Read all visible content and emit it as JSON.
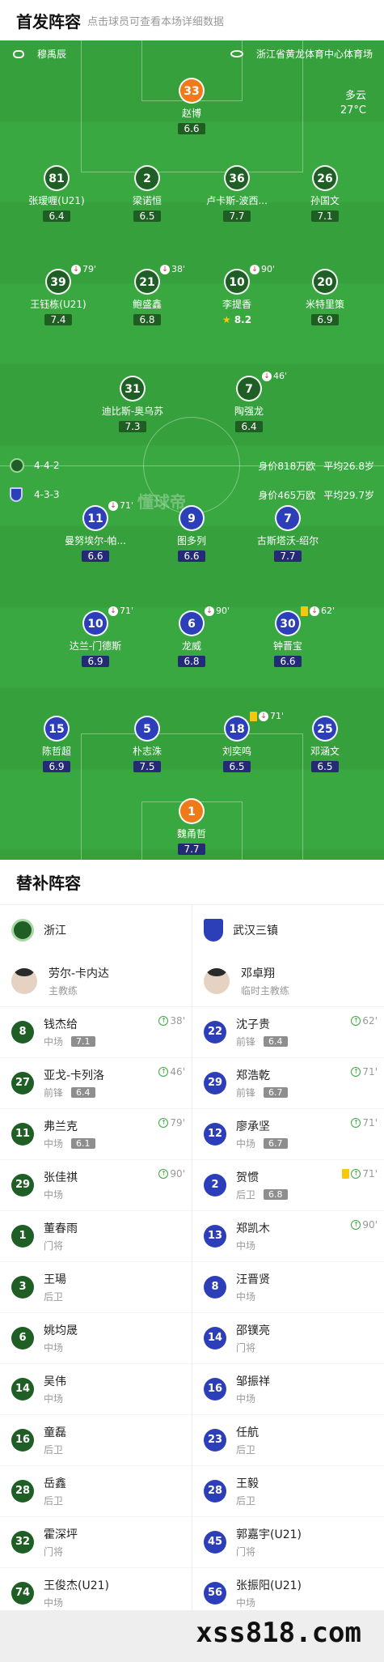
{
  "header": {
    "title": "首发阵容",
    "subtitle": "点击球员可查看本场详细数据"
  },
  "match_info": {
    "referee": "穆禹辰",
    "stadium": "浙江省黄龙体育中心体育场",
    "weather": "多云",
    "temperature": "27°C"
  },
  "watermark": "懂球帝",
  "home_team_info": {
    "formation": "4-4-2",
    "value": "身价818万欧",
    "age": "平均26.8岁"
  },
  "away_team_info": {
    "formation": "4-3-3",
    "value": "身价465万欧",
    "age": "平均29.7岁"
  },
  "colors": {
    "home": "#1f5e24",
    "away": "#2d3fb8",
    "keeper": "#f07a1a",
    "pitch": "#36a13c"
  },
  "home_lineup": [
    {
      "num": "33",
      "name": "赵博",
      "rating": "6.6",
      "keeper": true
    },
    {
      "num": "81",
      "name": "张瑷喱(U21)",
      "rating": "6.4"
    },
    {
      "num": "2",
      "name": "梁诺恒",
      "rating": "6.5",
      "event": "pink-ball"
    },
    {
      "num": "36",
      "name": "卢卡斯-波西...",
      "rating": "7.7",
      "captain": true,
      "event": "ball"
    },
    {
      "num": "26",
      "name": "孙国文",
      "rating": "7.1"
    },
    {
      "num": "39",
      "name": "王钰栋(U21)",
      "rating": "7.4",
      "sub": "79'",
      "event": "ball"
    },
    {
      "num": "21",
      "name": "鲍盛鑫",
      "rating": "6.8",
      "sub": "38'"
    },
    {
      "num": "10",
      "name": "李提香",
      "rating": "8.2",
      "sub": "90'",
      "star": true,
      "event": "assist"
    },
    {
      "num": "20",
      "name": "米特里策",
      "rating": "6.9",
      "event": "ball"
    },
    {
      "num": "31",
      "name": "迪比斯-奥乌苏",
      "rating": "7.3",
      "event": "assist"
    },
    {
      "num": "7",
      "name": "陶强龙",
      "rating": "6.4",
      "sub": "46'"
    }
  ],
  "away_lineup": [
    {
      "num": "11",
      "name": "曼努埃尔-帕...",
      "rating": "6.6",
      "sub": "71'"
    },
    {
      "num": "9",
      "name": "图多列",
      "rating": "6.6"
    },
    {
      "num": "7",
      "name": "古斯塔沃-绍尔",
      "rating": "7.7",
      "event": "assist"
    },
    {
      "num": "10",
      "name": "达兰-门德斯",
      "rating": "6.9",
      "sub": "71'"
    },
    {
      "num": "6",
      "name": "龙威",
      "rating": "6.8",
      "sub": "90'"
    },
    {
      "num": "30",
      "name": "钟晋宝",
      "rating": "6.6",
      "sub": "62'",
      "yellow": true
    },
    {
      "num": "15",
      "name": "陈哲超",
      "rating": "6.9"
    },
    {
      "num": "5",
      "name": "朴志洙",
      "rating": "7.5",
      "event": "ball"
    },
    {
      "num": "18",
      "name": "刘奕鸣",
      "rating": "6.5",
      "sub": "71'",
      "yellow": true,
      "captain": true
    },
    {
      "num": "25",
      "name": "邓涵文",
      "rating": "6.5"
    },
    {
      "num": "1",
      "name": "魏甬哲",
      "rating": "7.7",
      "keeper": true
    }
  ],
  "subs": {
    "title": "替补阵容",
    "home": {
      "team": "浙江",
      "coach": "劳尔-卡内达",
      "coach_role": "主教练",
      "players": [
        {
          "num": "8",
          "name": "钱杰给",
          "pos": "中场",
          "rating": "7.1",
          "event": "38'"
        },
        {
          "num": "27",
          "name": "亚戈-卡列洛",
          "pos": "前锋",
          "rating": "6.4",
          "event": "46'"
        },
        {
          "num": "11",
          "name": "弗兰克",
          "pos": "中场",
          "rating": "6.1",
          "event": "79'"
        },
        {
          "num": "29",
          "name": "张佳祺",
          "pos": "中场",
          "event": "90'"
        },
        {
          "num": "1",
          "name": "董春雨",
          "pos": "门将"
        },
        {
          "num": "3",
          "name": "王瑒",
          "pos": "后卫"
        },
        {
          "num": "6",
          "name": "姚均晟",
          "pos": "中场"
        },
        {
          "num": "14",
          "name": "吴伟",
          "pos": "中场"
        },
        {
          "num": "16",
          "name": "童磊",
          "pos": "后卫"
        },
        {
          "num": "28",
          "name": "岳鑫",
          "pos": "后卫"
        },
        {
          "num": "32",
          "name": "霍深坪",
          "pos": "门将"
        },
        {
          "num": "74",
          "name": "王俊杰(U21)",
          "pos": "中场"
        }
      ]
    },
    "away": {
      "team": "武汉三镇",
      "coach": "邓卓翔",
      "coach_role": "临时主教练",
      "players": [
        {
          "num": "22",
          "name": "沈子贵",
          "pos": "前锋",
          "rating": "6.4",
          "event": "62'"
        },
        {
          "num": "29",
          "name": "郑浩乾",
          "pos": "前锋",
          "rating": "6.7",
          "event": "71'"
        },
        {
          "num": "12",
          "name": "廖承坚",
          "pos": "中场",
          "rating": "6.7",
          "event": "71'"
        },
        {
          "num": "2",
          "name": "贺惯",
          "pos": "后卫",
          "rating": "6.8",
          "event": "71'"
        },
        {
          "num": "13",
          "name": "郑凯木",
          "pos": "中场",
          "event": "90'"
        },
        {
          "num": "8",
          "name": "汪晋贤",
          "pos": "中场"
        },
        {
          "num": "14",
          "name": "邵镤亮",
          "pos": "门将"
        },
        {
          "num": "16",
          "name": "邹振祥",
          "pos": "中场"
        },
        {
          "num": "23",
          "name": "任航",
          "pos": "后卫"
        },
        {
          "num": "28",
          "name": "王毅",
          "pos": "后卫"
        },
        {
          "num": "45",
          "name": "郭嘉宇(U21)",
          "pos": "门将"
        },
        {
          "num": "56",
          "name": "张振阳(U21)",
          "pos": "中场"
        }
      ]
    }
  },
  "footer": {
    "watermark": "xss818.com"
  }
}
